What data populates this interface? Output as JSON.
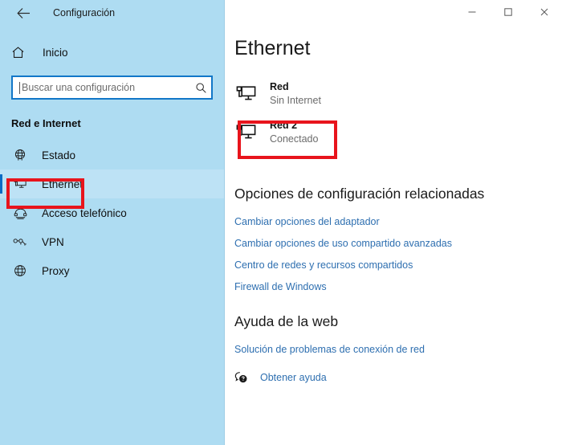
{
  "window": {
    "app_title": "Configuración",
    "back_icon": "back-arrow-icon",
    "controls": {
      "minimize": "−",
      "maximize": "□",
      "close": "✕"
    }
  },
  "sidebar": {
    "home": {
      "label": "Inicio",
      "icon": "home-icon"
    },
    "search": {
      "placeholder": "Buscar una configuración",
      "value": "",
      "icon": "search-icon"
    },
    "section_title": "Red e Internet",
    "items": [
      {
        "label": "Estado",
        "icon": "globe-icon",
        "selected": false
      },
      {
        "label": "Ethernet",
        "icon": "ethernet-monitor-icon",
        "selected": true
      },
      {
        "label": "Acceso telefónico",
        "icon": "phone-handset-icon",
        "selected": false
      },
      {
        "label": "VPN",
        "icon": "vpn-icon",
        "selected": false
      },
      {
        "label": "Proxy",
        "icon": "globe-outline-icon",
        "selected": false
      }
    ]
  },
  "main": {
    "page_title": "Ethernet",
    "networks": [
      {
        "name": "Red",
        "status": "Sin Internet",
        "icon": "ethernet-monitor-icon"
      },
      {
        "name": "Red 2",
        "status": "Conectado",
        "icon": "ethernet-monitor-icon"
      }
    ],
    "related_settings": {
      "heading": "Opciones de configuración relacionadas",
      "links": [
        "Cambiar opciones del adaptador",
        "Cambiar opciones de uso compartido avanzadas",
        "Centro de redes y recursos compartidos",
        "Firewall de Windows"
      ]
    },
    "web_help": {
      "heading": "Ayuda de la web",
      "links": [
        "Solución de problemas de conexión de red"
      ],
      "get_help": {
        "label": "Obtener ayuda",
        "icon": "help-bubble-icon"
      }
    }
  },
  "annotations": {
    "color": "#e8141c",
    "boxes": [
      {
        "target": "sidebar-item-ethernet"
      },
      {
        "target": "network-item-red-2"
      }
    ]
  },
  "colors": {
    "sidebar_bg": "#aedcf2",
    "accent": "#0a6cc4",
    "link": "#2e6fb0",
    "annotation_red": "#e8141c"
  }
}
